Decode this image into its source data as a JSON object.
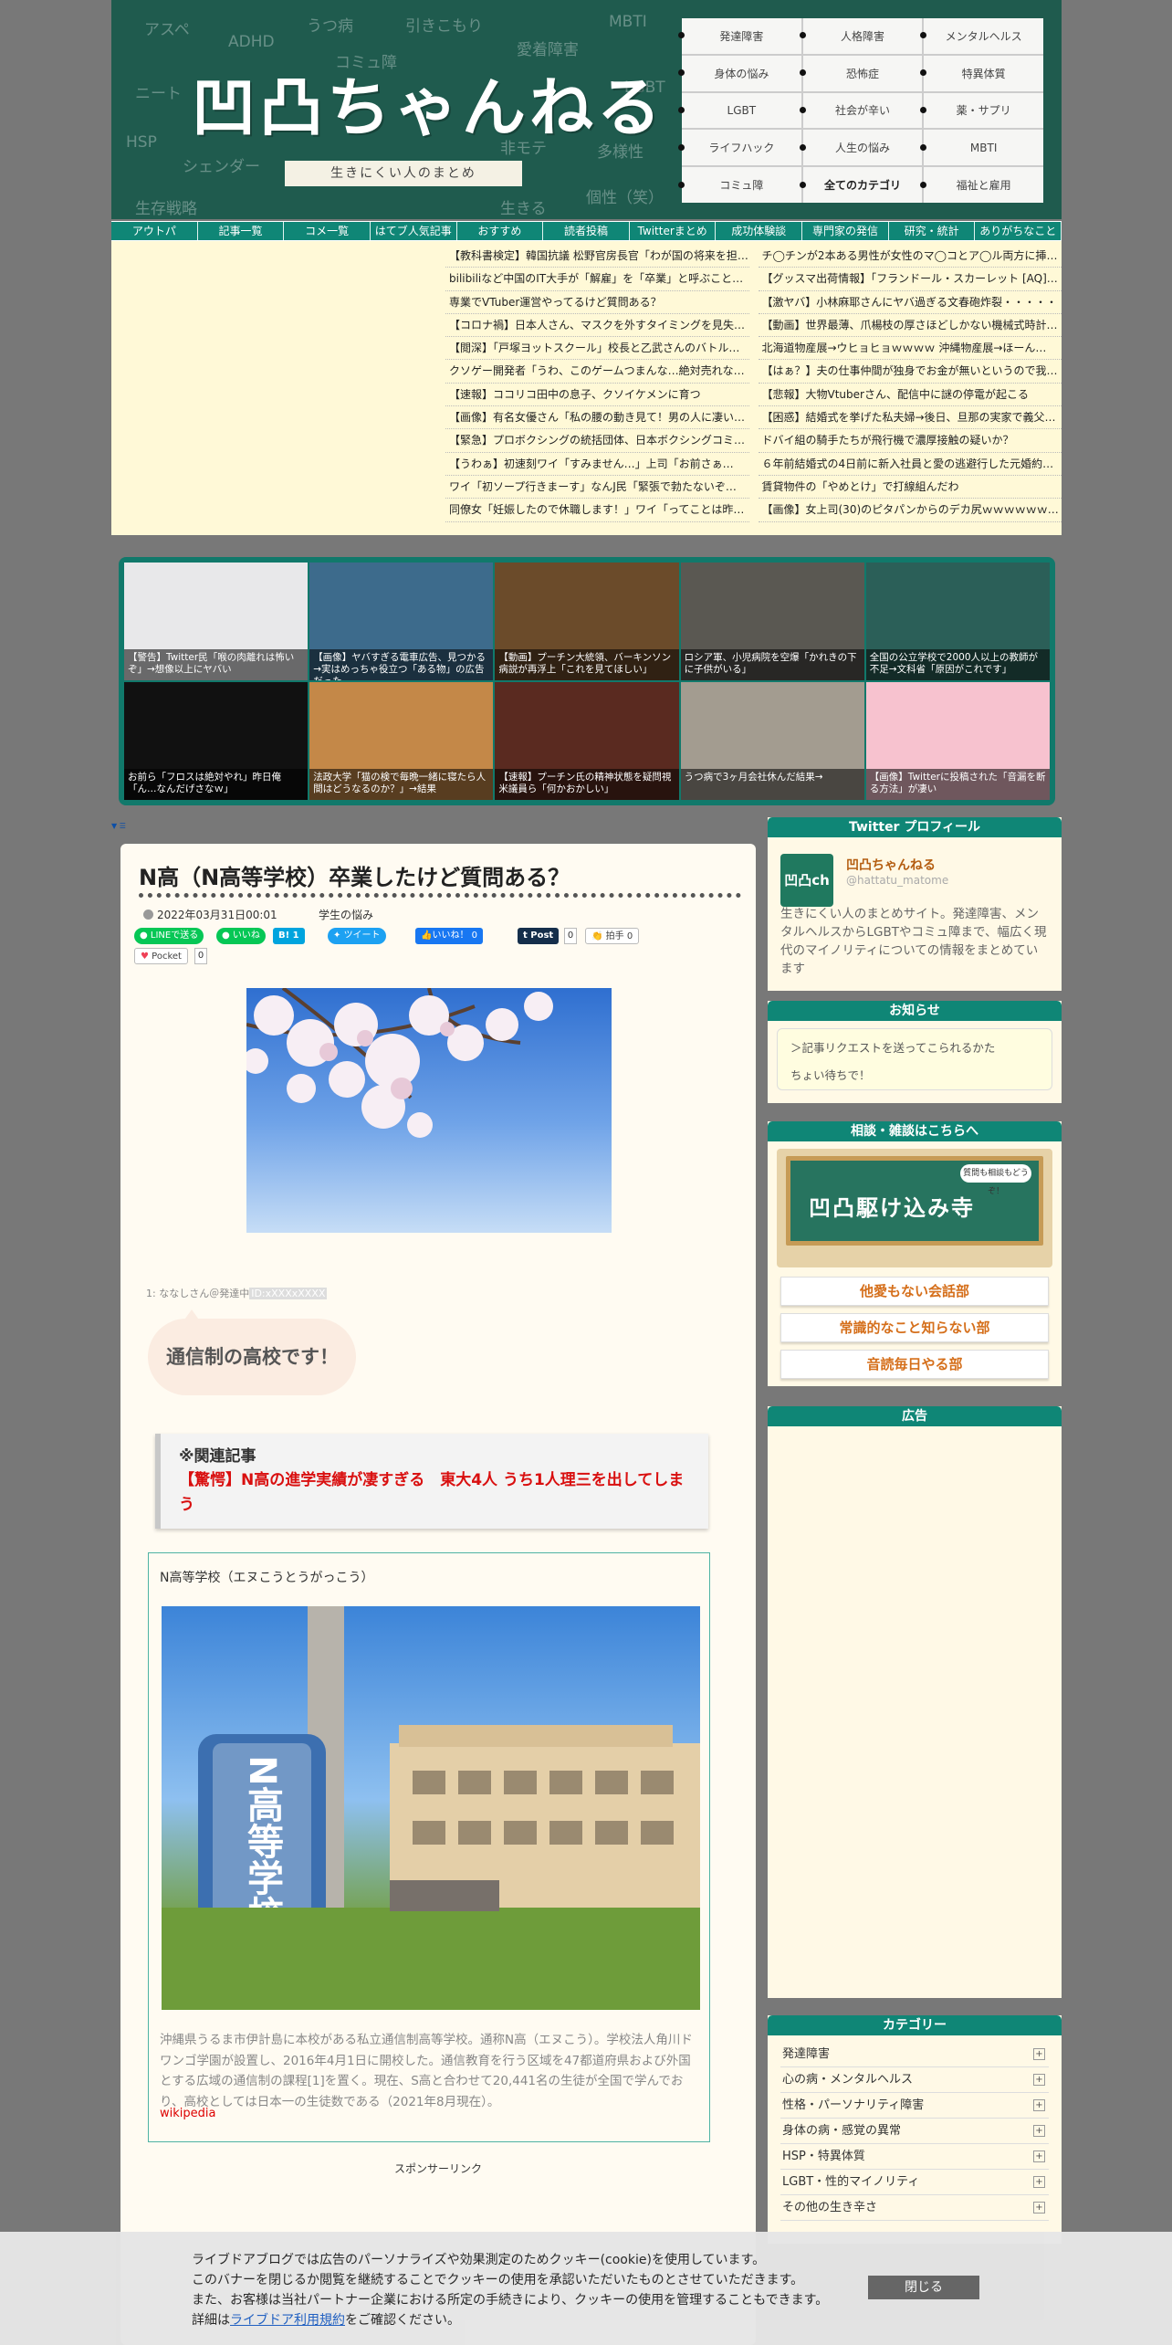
{
  "header": {
    "logo": "凹凸ちゃんねる",
    "tagline": "生きにくい人のまとめ",
    "chalk_words": [
      "アスペ",
      "ADHD",
      "うつ病",
      "引きこもり",
      "MBTI",
      "コミュ障",
      "愛着障害",
      "ニート",
      "LGBT",
      "HSP",
      "シェンダー",
      "非モテ",
      "多様性",
      "生存戦略",
      "生きる",
      "個性（笑）"
    ]
  },
  "categories": [
    "発達障害",
    "人格障害",
    "メンタルヘルス",
    "身体の悩み",
    "恐怖症",
    "特異体質",
    "LGBT",
    "社会が辛い",
    "薬・サプリ",
    "ライフハック",
    "人生の悩み",
    "MBTI",
    "コミュ障",
    "全てのカテゴリ",
    "福祉と雇用"
  ],
  "nav": [
    "アウトパ",
    "記事一覧",
    "コメ一覧",
    "はてブ人気記事",
    "おすすめ",
    "読者投稿",
    "Twitterまとめ",
    "成功体験談",
    "専門家の発信",
    "研究・統計",
    "ありがちなこと"
  ],
  "ticker": [
    "【教科書検定】韓国抗議 松野官房長官「わが国の将来を担う…",
    "チ◯チンが2本ある男性が女性のマ◯コとア◯ル両方に挿入す…",
    "bilibiliなど中国のIT大手が「解雇」を「卒業」と呼ぶことに…",
    "【グッスマ出荷情報】「フランドール・スカーレット [AQ]…",
    "専業でVTuber運営やってるけど質問ある？",
    "【激ヤバ】小林麻耶さんにヤバ過ぎる文春砲炸裂・・・・・",
    "【コロナ禍】日本人さん、マスクを外すタイミングを見失…",
    "【動画】世界最薄、爪楊枝の厚さほどしかない機械式時計…",
    "【閲深】「戸塚ヨットスクール」校長と乙武さんのバトル…",
    "北海道物産展→ウヒョヒョｗｗｗｗ 沖縄物産展→ほーん…",
    "クソゲー開発者「うわ、このゲームつまんな…絶対売れな…",
    "【はぁ？】夫の仕事仲間が独身でお金が無いというので我…",
    "【速報】ココリコ田中の息子、クソイケメンに育つ",
    "【悲報】大物Vtuberさん、配信中に謎の停電が起こる",
    "【画像】有名女優さん「私の腰の動き見て！男の人に凄い…",
    "【困惑】結婚式を挙げた私夫婦→後日、旦那の実家で義父…",
    "【緊急】プロボクシングの統括団体、日本ボクシングコミ…",
    "ドバイ組の騎手たちが飛行機で濃厚接触の疑いか？",
    "【うわぁ】初速刻ワイ「すみません…」上司「お前さぁ…",
    "６年前結婚式の4日前に新入社員と愛の逃避行した元婚約…",
    "ワイ「初ソープ行きまーす」なんJ民「緊張で勃たないぞ…",
    "賃貸物件の「やめとけ」で打線組んだわ",
    "同僚女「妊娠したので休職します！」ワイ「ってことは昨…",
    "【画像】女上司(30)のピタパンからのデカ尻ｗｗｗｗｗｗ…"
  ],
  "gallery": [
    {
      "caption": "【警告】Twitter民「喉の肉離れは怖いぞ」→想像以上にヤバい",
      "bg": "#e8e8ea"
    },
    {
      "caption": "【画像】ヤバすぎる電車広告、見つかる→実はめっちゃ役立つ「ある物」の広告だった…",
      "bg": "#3d6b8c"
    },
    {
      "caption": "【動画】プーチン大統領、バーキンソン病説が再浮上「これを見てほしい」",
      "bg": "#6b4b2a"
    },
    {
      "caption": "ロシア軍、小児病院を空爆「かれきの下に子供がいる」",
      "bg": "#5a5852"
    },
    {
      "caption": "全国の公立学校で2000人以上の教師が不足→文科省「原因がこれです」",
      "bg": "#2b5f58"
    },
    {
      "caption": "お前ら「フロスは絶対やれ」昨日俺「ん…なんだげさなｗ」",
      "bg": "#111111"
    },
    {
      "caption": "法政大学「猫の検で毎晩一緒に寝たら人間はどうなるのか？」→結果",
      "bg": "#c48848"
    },
    {
      "caption": "【速報】プーチン氏の精神状態を疑問視 米議員ら「何かおかしい」",
      "bg": "#5a2a20"
    },
    {
      "caption": "うつ病で3ヶ月会社休んだ結果→",
      "bg": "#a39c90"
    },
    {
      "caption": "【画像】Twitterに投稿された「音漏を断る方法」が凄い",
      "bg": "#f7c2cf"
    }
  ],
  "tiny_link": "▼ ☰",
  "article": {
    "title": "N高（N高等学校）卒業したけど質問ある？",
    "date": "2022年03月31日00:01",
    "category": "学生の悩み",
    "share": {
      "line": "LINEで送る",
      "like": "いいね",
      "hatena": "B! 1",
      "tweet": "ツイート",
      "fb_like": "いいね！ 0",
      "tumblr": "Post",
      "tumblr_count": "0",
      "clap": "拍手 0",
      "pocket": "Pocket",
      "pocket_count": "0"
    },
    "res_meta": "1: ななしさん＠発達中",
    "res_id": "ID:xXXXxXXXX",
    "res_text": "通信制の高校です！",
    "related_head": "※関連記事",
    "related_link": "【驚愕】N高の進学実績が凄すぎる　東大4人 うち1人理三を出してしまう",
    "wiki_head": "N高等学校（エヌこうとうがっこう）",
    "wiki_text": "沖縄県うるま市伊計島に本校がある私立通信制高等学校。通称N高（エヌこう）。学校法人角川ドワンゴ学園が設置し、2016年4月1日に開校した。通信教育を行う区域を47都道府県および外国とする広域の通信制の課程[1]を置く。現在、S高と合わせて20,441名の生徒が全国で学んでおり、高校としては日本一の生徒数である（2021年8月現在）。",
    "wiki_src": "wikipedia",
    "sponsor": "スポンサーリンク"
  },
  "sidebar": {
    "twitter_head": "Twitter プロフィール",
    "twitter_icon": "凹凸ch",
    "twitter_name": "凹凸ちゃんねる",
    "twitter_handle": "@hattatu_matome",
    "twitter_desc": "生きにくい人のまとめサイト。発達障害、メンタルヘルスからLGBTやコミュ障まで、幅広く現代のマイノリティについての情報をまとめています",
    "notice_head": "お知らせ",
    "notice_lines": [
      "＞記事リクエストを送ってこられるかた",
      "ちょい待ちで！"
    ],
    "consult_head": "相談・雑談はこちらへ",
    "banner_text": "凹凸駆け込み寺",
    "banner_bubble": "質問も相談もどうぞ！",
    "buttons": [
      "他愛もない会話部",
      "常識的なこと知らない部",
      "音読毎日やる部"
    ],
    "ad_head": "広告",
    "category_head": "カテゴリー",
    "category_items": [
      "発達障害",
      "心の病・メンタルヘルス",
      "性格・パーソナリティ障害",
      "身体の病・感覚の異常",
      "HSP・特異体質",
      "LGBT・性的マイノリティ",
      "その他の生き辛さ"
    ],
    "plus": "+"
  },
  "cookie": {
    "lines": [
      "ライブドアブログでは広告のパーソナライズや効果測定のためクッキー(cookie)を使用しています。",
      "このバナーを閉じるか閲覧を継続することでクッキーの使用を承認いただいたものとさせていただきます。",
      "また、お客様は当社パートナー企業における所定の手続きにより、クッキーの使用を管理することもできます。"
    ],
    "detail_prefix": "詳細は",
    "detail_link": "ライブドア利用規約",
    "detail_suffix": "をご確認ください。",
    "close": "閉じる"
  }
}
